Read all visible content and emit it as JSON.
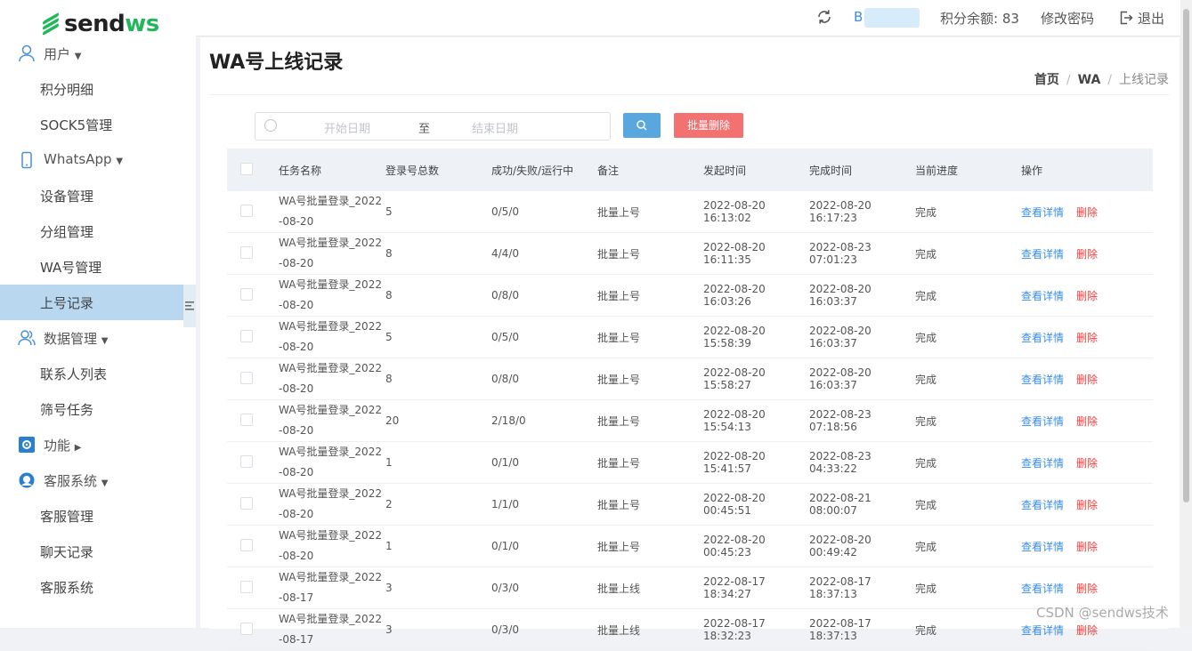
{
  "logo": {
    "part1": "send",
    "part2": "ws"
  },
  "topbar": {
    "username": "B",
    "points_label": "积分余额: 83",
    "change_password": "修改密码",
    "logout": "退出"
  },
  "sidebar": {
    "groups": {
      "user": {
        "label": "用户",
        "items": [
          "积分明细",
          "SOCK5管理"
        ]
      },
      "whatsapp": {
        "label": "WhatsApp",
        "items": [
          "设备管理",
          "分组管理",
          "WA号管理",
          "上号记录"
        ]
      },
      "data": {
        "label": "数据管理",
        "items": [
          "联系人列表",
          "筛号任务"
        ]
      },
      "func": {
        "label": "功能"
      },
      "cs": {
        "label": "客服系统",
        "items": [
          "客服管理",
          "聊天记录",
          "客服系统"
        ]
      }
    },
    "active_item": "上号记录"
  },
  "page": {
    "title": "WA号上线记录",
    "breadcrumb": [
      "首页",
      "WA",
      "上线记录"
    ]
  },
  "filters": {
    "start_placeholder": "开始日期",
    "to": "至",
    "end_placeholder": "结束日期",
    "batch_delete": "批量删除"
  },
  "table": {
    "headers": [
      "任务名称",
      "登录号总数",
      "成功/失败/运行中",
      "备注",
      "发起时间",
      "完成时间",
      "当前进度",
      "操作"
    ],
    "action_detail": "查看详情",
    "action_delete": "删除",
    "rows": [
      [
        "WA号批量登录_2022-08-20",
        "5",
        "0/5/0",
        "批量上号",
        "2022-08-20 16:13:02",
        "2022-08-20 16:17:23",
        "完成"
      ],
      [
        "WA号批量登录_2022-08-20",
        "8",
        "4/4/0",
        "批量上号",
        "2022-08-20 16:11:35",
        "2022-08-23 07:01:23",
        "完成"
      ],
      [
        "WA号批量登录_2022-08-20",
        "8",
        "0/8/0",
        "批量上号",
        "2022-08-20 16:03:26",
        "2022-08-20 16:03:37",
        "完成"
      ],
      [
        "WA号批量登录_2022-08-20",
        "5",
        "0/5/0",
        "批量上号",
        "2022-08-20 15:58:39",
        "2022-08-20 16:03:37",
        "完成"
      ],
      [
        "WA号批量登录_2022-08-20",
        "8",
        "0/8/0",
        "批量上号",
        "2022-08-20 15:58:27",
        "2022-08-20 16:03:37",
        "完成"
      ],
      [
        "WA号批量登录_2022-08-20",
        "20",
        "2/18/0",
        "批量上号",
        "2022-08-20 15:54:13",
        "2022-08-23 07:18:56",
        "完成"
      ],
      [
        "WA号批量登录_2022-08-20",
        "1",
        "0/1/0",
        "批量上号",
        "2022-08-20 15:41:57",
        "2022-08-23 04:33:22",
        "完成"
      ],
      [
        "WA号批量登录_2022-08-20",
        "2",
        "1/1/0",
        "批量上号",
        "2022-08-20 00:45:51",
        "2022-08-21 08:00:07",
        "完成"
      ],
      [
        "WA号批量登录_2022-08-20",
        "1",
        "0/1/0",
        "批量上号",
        "2022-08-20 00:45:23",
        "2022-08-20 00:49:42",
        "完成"
      ],
      [
        "WA号批量登录_2022-08-17",
        "3",
        "0/3/0",
        "批量上线",
        "2022-08-17 18:34:27",
        "2022-08-17 18:37:13",
        "完成"
      ],
      [
        "WA号批量登录_2022-08-17",
        "3",
        "0/3/0",
        "批量上线",
        "2022-08-17 18:32:23",
        "2022-08-17 18:37:13",
        "完成"
      ]
    ]
  },
  "watermark": "CSDN @sendws技术"
}
